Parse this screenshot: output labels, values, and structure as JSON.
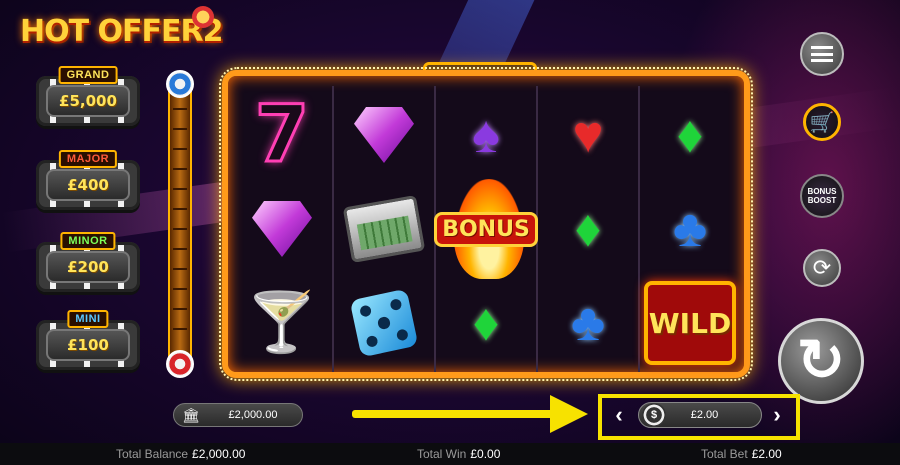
{
  "game": {
    "logo_text": "HOT OFFER",
    "logo_number": "2"
  },
  "jackpots": [
    {
      "label": "GRAND",
      "value": "£5,000"
    },
    {
      "label": "MAJOR",
      "value": "£400"
    },
    {
      "label": "MINOR",
      "value": "£200"
    },
    {
      "label": "MINI",
      "value": "£100"
    }
  ],
  "reels": [
    [
      "seven",
      "purple-diamond-gem",
      "martini-glass"
    ],
    [
      "purple-diamond-gem",
      "money-briefcase",
      "blue-dice"
    ],
    [
      "spade",
      "bonus",
      "green-diamond"
    ],
    [
      "heart",
      "green-diamond",
      "club"
    ],
    [
      "green-diamond",
      "club",
      "wild"
    ]
  ],
  "symbols": {
    "seven": "7",
    "spade": "♠",
    "heart": "♥",
    "green_diamond": "♦",
    "club": "♣",
    "martini": "🍸",
    "bonus": "BONUS",
    "wild": "WILD"
  },
  "controls": {
    "boost_label": "BONUS\nBOOST",
    "cart_icon": "🛒",
    "auto_icon": "⟳",
    "spin_icon": "↻"
  },
  "balance_pill": {
    "value": "£2,000.00",
    "icon": "bank-icon"
  },
  "bet": {
    "value": "£2.00",
    "prev": "‹",
    "next": "›",
    "coin": "$"
  },
  "status": {
    "total_balance_label": "Total Balance",
    "total_balance_value": "£2,000.00",
    "total_win_label": "Total Win",
    "total_win_value": "£0.00",
    "total_bet_label": "Total Bet",
    "total_bet_value": "£2.00"
  },
  "colors": {
    "accent": "#ffb400",
    "highlight": "#f7e200",
    "frame": "#ff9a1a"
  }
}
